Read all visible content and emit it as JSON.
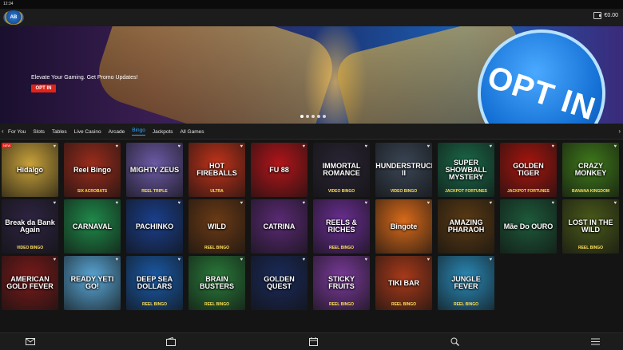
{
  "status": {
    "time": "12:34"
  },
  "header": {
    "logo_text": "AB",
    "balance": "€0.00",
    "wallet_icon": "wallet-icon"
  },
  "banner": {
    "text": "Elevate Your Gaming. Get Promo Updates!",
    "button": "OPT IN",
    "art_text": "OPT IN"
  },
  "categories": {
    "items": [
      "For You",
      "Slots",
      "Tables",
      "Live Casino",
      "Arcade",
      "Bingo",
      "Jackpots",
      "All Games"
    ],
    "active": "Bingo"
  },
  "games": [
    {
      "name": "Hidalgo",
      "sub": "",
      "bg": "#c9a23a",
      "badge": "NEW"
    },
    {
      "name": "Reel Bingo",
      "sub": "SIX ACROBATS",
      "bg": "#9b2c1c",
      "badge": ""
    },
    {
      "name": "MIGHTY ZEUS",
      "sub": "REEL TRIPLE",
      "bg": "#6c5aa6",
      "badge": ""
    },
    {
      "name": "HOT FIREBALLS",
      "sub": "ULTRA",
      "bg": "#c2331a",
      "badge": ""
    },
    {
      "name": "FU 88",
      "sub": "",
      "bg": "#b2151a",
      "badge": ""
    },
    {
      "name": "IMMORTAL ROMANCE",
      "sub": "VIDEO BINGO",
      "bg": "#2a2434",
      "badge": ""
    },
    {
      "name": "THUNDERSTRUCK II",
      "sub": "VIDEO BINGO",
      "bg": "#3a4656",
      "badge": ""
    },
    {
      "name": "SUPER SHOWBALL MYSTERY",
      "sub": "JACKPOT FORTUNES",
      "bg": "#1a6a4a",
      "badge": ""
    },
    {
      "name": "GOLDEN TIGER",
      "sub": "JACKPOT FORTUNES",
      "bg": "#a8150e",
      "badge": ""
    },
    {
      "name": "CRAZY MONKEY",
      "sub": "BANANA KINGDOM",
      "bg": "#3f7a1a",
      "badge": ""
    },
    {
      "name": "Break da Bank Again",
      "sub": "VIDEO BINGO",
      "bg": "#2e2442",
      "badge": ""
    },
    {
      "name": "CARNAVAL",
      "sub": "",
      "bg": "#1f8a4a",
      "badge": ""
    },
    {
      "name": "PACHINKO",
      "sub": "",
      "bg": "#1a3f8c",
      "badge": ""
    },
    {
      "name": "WILD",
      "sub": "REEL BINGO",
      "bg": "#6b3a15",
      "badge": ""
    },
    {
      "name": "CATRINA",
      "sub": "",
      "bg": "#5a2a74",
      "badge": ""
    },
    {
      "name": "REELS & RICHES",
      "sub": "REEL BINGO",
      "bg": "#6a2e92",
      "badge": ""
    },
    {
      "name": "Bingote",
      "sub": "",
      "bg": "#d86a1a",
      "badge": ""
    },
    {
      "name": "AMAZING PHARAOH",
      "sub": "",
      "bg": "#5a3a14",
      "badge": ""
    },
    {
      "name": "Mãe Do OURO",
      "sub": "",
      "bg": "#1d5a3a",
      "badge": ""
    },
    {
      "name": "LOST IN THE WILD",
      "sub": "REEL BINGO",
      "bg": "#4a5a1a",
      "badge": ""
    },
    {
      "name": "AMERICAN GOLD FEVER",
      "sub": "",
      "bg": "#7a1a1a",
      "badge": ""
    },
    {
      "name": "READY YETI GO!",
      "sub": "",
      "bg": "#5aa8d8",
      "badge": ""
    },
    {
      "name": "DEEP SEA DOLLARS",
      "sub": "REEL BINGO",
      "bg": "#1a5aa8",
      "badge": ""
    },
    {
      "name": "BRAIN BUSTERS",
      "sub": "REEL BINGO",
      "bg": "#2a7a3a",
      "badge": ""
    },
    {
      "name": "GOLDEN QUEST",
      "sub": "",
      "bg": "#1a2a5a",
      "badge": ""
    },
    {
      "name": "STICKY FRUITS",
      "sub": "REEL BINGO",
      "bg": "#7a3a9a",
      "badge": ""
    },
    {
      "name": "TIKI BAR",
      "sub": "REEL BINGO",
      "bg": "#a83a1a",
      "badge": ""
    },
    {
      "name": "JUNGLE FEVER",
      "sub": "REEL BINGO",
      "bg": "#2a8ab8",
      "badge": ""
    }
  ],
  "footer": {
    "icons": [
      "mail-icon",
      "wallet-icon",
      "calendar-icon",
      "search-icon",
      "menu-icon"
    ]
  },
  "colors": {
    "accent": "#2fa8ff",
    "cta": "#e2231a"
  }
}
